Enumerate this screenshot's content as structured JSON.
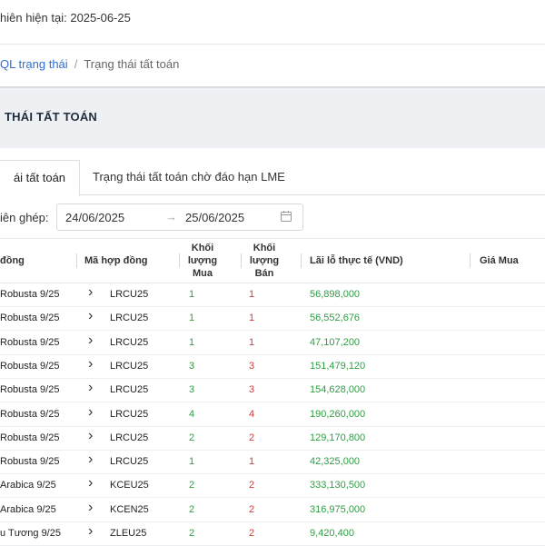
{
  "header": {
    "session_text": "hiên hiện tại: 2025-06-25"
  },
  "breadcrumb": {
    "parent": "QL trạng thái",
    "separator": "/",
    "current": "Trạng thái tất toán"
  },
  "panel": {
    "title": "THÁI TẤT TOÁN"
  },
  "tabs": [
    {
      "label": "ái tất toán",
      "active": true
    },
    {
      "label": "Trạng thái tất toán chờ đáo hạn LME",
      "active": false
    }
  ],
  "filter": {
    "label": "iên ghép:",
    "from": "24/06/2025",
    "arrow": "→",
    "to": "25/06/2025"
  },
  "table": {
    "headers": {
      "product": "đồng",
      "contract_code": "Mã hợp đồng",
      "qty_buy": [
        "Khối",
        "lượng",
        "Mua"
      ],
      "qty_sell": [
        "Khối",
        "lượng",
        "Bán"
      ],
      "pnl": "Lãi lỗ thực tế (VND)",
      "buy_price": "Giá Mua"
    },
    "rows": [
      {
        "product": "Robusta 9/25",
        "code": "LRCU25",
        "buy": "1",
        "sell": "1",
        "pnl": "56,898,000"
      },
      {
        "product": "Robusta 9/25",
        "code": "LRCU25",
        "buy": "1",
        "sell": "1",
        "pnl": "56,552,676"
      },
      {
        "product": "Robusta 9/25",
        "code": "LRCU25",
        "buy": "1",
        "sell": "1",
        "pnl": "47,107,200"
      },
      {
        "product": "Robusta 9/25",
        "code": "LRCU25",
        "buy": "3",
        "sell": "3",
        "pnl": "151,479,120"
      },
      {
        "product": "Robusta 9/25",
        "code": "LRCU25",
        "buy": "3",
        "sell": "3",
        "pnl": "154,628,000"
      },
      {
        "product": "Robusta 9/25",
        "code": "LRCU25",
        "buy": "4",
        "sell": "4",
        "pnl": "190,260,000"
      },
      {
        "product": "Robusta 9/25",
        "code": "LRCU25",
        "buy": "2",
        "sell": "2",
        "pnl": "129,170,800"
      },
      {
        "product": "Robusta 9/25",
        "code": "LRCU25",
        "buy": "1",
        "sell": "1",
        "pnl": "42,325,000"
      },
      {
        "product": "Arabica 9/25",
        "code": "KCEU25",
        "buy": "2",
        "sell": "2",
        "pnl": "333,130,500"
      },
      {
        "product": "Arabica 9/25",
        "code": "KCEN25",
        "buy": "2",
        "sell": "2",
        "pnl": "316,975,000"
      },
      {
        "product": "u Tương 9/25",
        "code": "ZLEU25",
        "buy": "2",
        "sell": "2",
        "pnl": "9,420,400"
      }
    ]
  },
  "colors": {
    "link": "#2f6fd1",
    "buy": "#2e9e44",
    "sell": "#d13a3a",
    "pnl_positive": "#2e9e44",
    "panel_bg": "#eef0f4"
  },
  "icons": {
    "row_expand": "chevron-right-icon",
    "date_picker": "calendar-icon",
    "range_separator": "arrow-right-icon"
  }
}
